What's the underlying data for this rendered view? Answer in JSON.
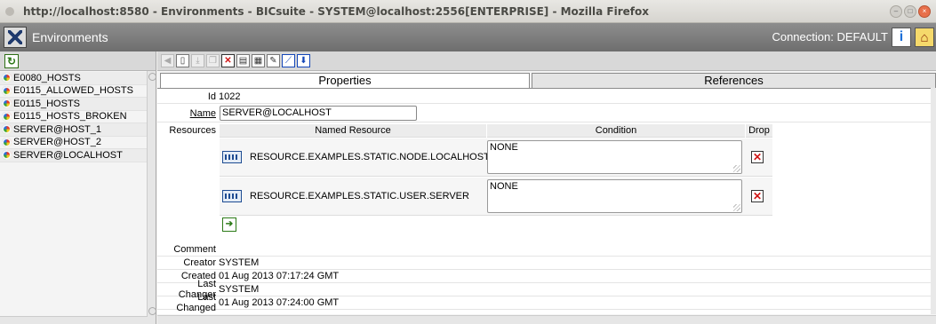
{
  "window": {
    "title": "http://localhost:8580 - Environments - BICsuite - SYSTEM@localhost:2556[ENTERPRISE] - Mozilla Firefox"
  },
  "app": {
    "title": "Environments",
    "connection": "Connection: DEFAULT"
  },
  "sidebar": {
    "items": [
      {
        "label": "E0080_HOSTS"
      },
      {
        "label": "E0115_ALLOWED_HOSTS"
      },
      {
        "label": "E0115_HOSTS"
      },
      {
        "label": "E0115_HOSTS_BROKEN"
      },
      {
        "label": "SERVER@HOST_1"
      },
      {
        "label": "SERVER@HOST_2"
      },
      {
        "label": "SERVER@LOCALHOST"
      }
    ]
  },
  "tabs": {
    "properties": "Properties",
    "references": "References"
  },
  "form": {
    "id_label": "Id",
    "id_value": "1022",
    "name_label": "Name",
    "name_value": "SERVER@LOCALHOST",
    "resources_label": "Resources",
    "comment_label": "Comment",
    "creator_label": "Creator",
    "creator_value": "SYSTEM",
    "created_label": "Created",
    "created_value": "01 Aug 2013 07:17:24 GMT",
    "last_changer_label": "Last Changer",
    "last_changer_value": "SYSTEM",
    "last_changed_label": "Last Changed",
    "last_changed_value": "01 Aug 2013 07:24:00 GMT"
  },
  "resources": {
    "headers": {
      "named_resource": "Named Resource",
      "condition": "Condition",
      "drop": "Drop"
    },
    "rows": [
      {
        "name": "RESOURCE.EXAMPLES.STATIC.NODE.LOCALHOST",
        "condition": "NONE"
      },
      {
        "name": "RESOURCE.EXAMPLES.STATIC.USER.SERVER",
        "condition": "NONE"
      }
    ]
  }
}
